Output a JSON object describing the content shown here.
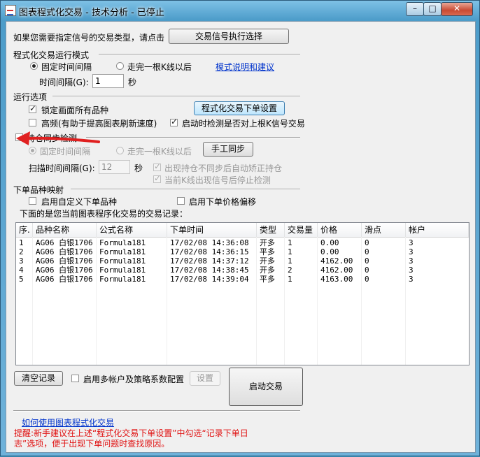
{
  "window": {
    "title": "图表程式化交易 - 技术分析 - 已停止",
    "min_label": "–",
    "max_label": "□",
    "close_label": "✕"
  },
  "header": {
    "prompt": "如果您需要指定信号的交易类型，请点击",
    "signal_button": "交易信号执行选择"
  },
  "run_mode": {
    "section_label": "程式化交易运行模式",
    "fixed_interval_label": "固定时间间隔",
    "bar_complete_label": "走完一根K线以后",
    "help_link": "模式说明和建议",
    "interval_label": "时间间隔(G):",
    "interval_value": "1",
    "interval_unit": "秒"
  },
  "options": {
    "section_label": "运行选项",
    "lock_label": "锁定画面所有品种",
    "order_settings_button": "程式化交易下单设置",
    "high_freq_label": "高频(有助于提高图表刷新速度)",
    "check_signal_label": "启动时检测是否对上根K信号交易"
  },
  "position_sync": {
    "section_label": "持仓同步检测",
    "fixed_interval_label": "固定时间间隔",
    "bar_complete_label": "走完一根K线以后",
    "manual_sync_button": "手工同步",
    "scan_label": "扫描时间间隔(G):",
    "scan_value": "12",
    "scan_unit": "秒",
    "auto_fix_label": "出现持仓不同步后自动矫正持仓",
    "stop_check_label": "当前K线出现信号后停止检测"
  },
  "mapping": {
    "section_label": "下单品种映射",
    "custom_symbol_label": "启用自定义下单品种",
    "price_offset_label": "启用下单价格偏移",
    "records_caption": "下面的是您当前图表程序化交易的交易记录："
  },
  "table": {
    "columns": [
      "序.",
      "品种名称",
      "公式名称",
      "下单时间",
      "类型",
      "交易量",
      "价格",
      "滑点",
      "帐户"
    ],
    "rows": [
      [
        "1",
        "AG06 白银1706",
        "Formula181",
        "17/02/08 14:36:08",
        "开多",
        "1",
        "0.00",
        "0",
        "3"
      ],
      [
        "2",
        "AG06 白银1706",
        "Formula181",
        "17/02/08 14:36:15",
        "平多",
        "1",
        "0.00",
        "0",
        "3"
      ],
      [
        "3",
        "AG06 白银1706",
        "Formula181",
        "17/02/08 14:37:12",
        "开多",
        "1",
        "4162.00",
        "0",
        "3"
      ],
      [
        "4",
        "AG06 白银1706",
        "Formula181",
        "17/02/08 14:38:45",
        "开多",
        "2",
        "4162.00",
        "0",
        "3"
      ],
      [
        "5",
        "AG06 白银1706",
        "Formula181",
        "17/02/08 14:39:04",
        "平多",
        "1",
        "4163.00",
        "0",
        "3"
      ]
    ]
  },
  "bottom": {
    "clear_button": "清空记录",
    "multi_account_label": "启用多帐户及策略系数配置",
    "settings_button": "设置",
    "start_button": "启动交易",
    "howto_link": "如何使用图表程式化交易",
    "warning": "提醒:新手建议在上述“程式化交易下单设置”中勾选“记录下单日志”选项，便于出现下单问题时查找原因。"
  },
  "colors": {
    "arrow": "#e02020",
    "warning_text": "#e01010",
    "link": "#0033cc"
  }
}
